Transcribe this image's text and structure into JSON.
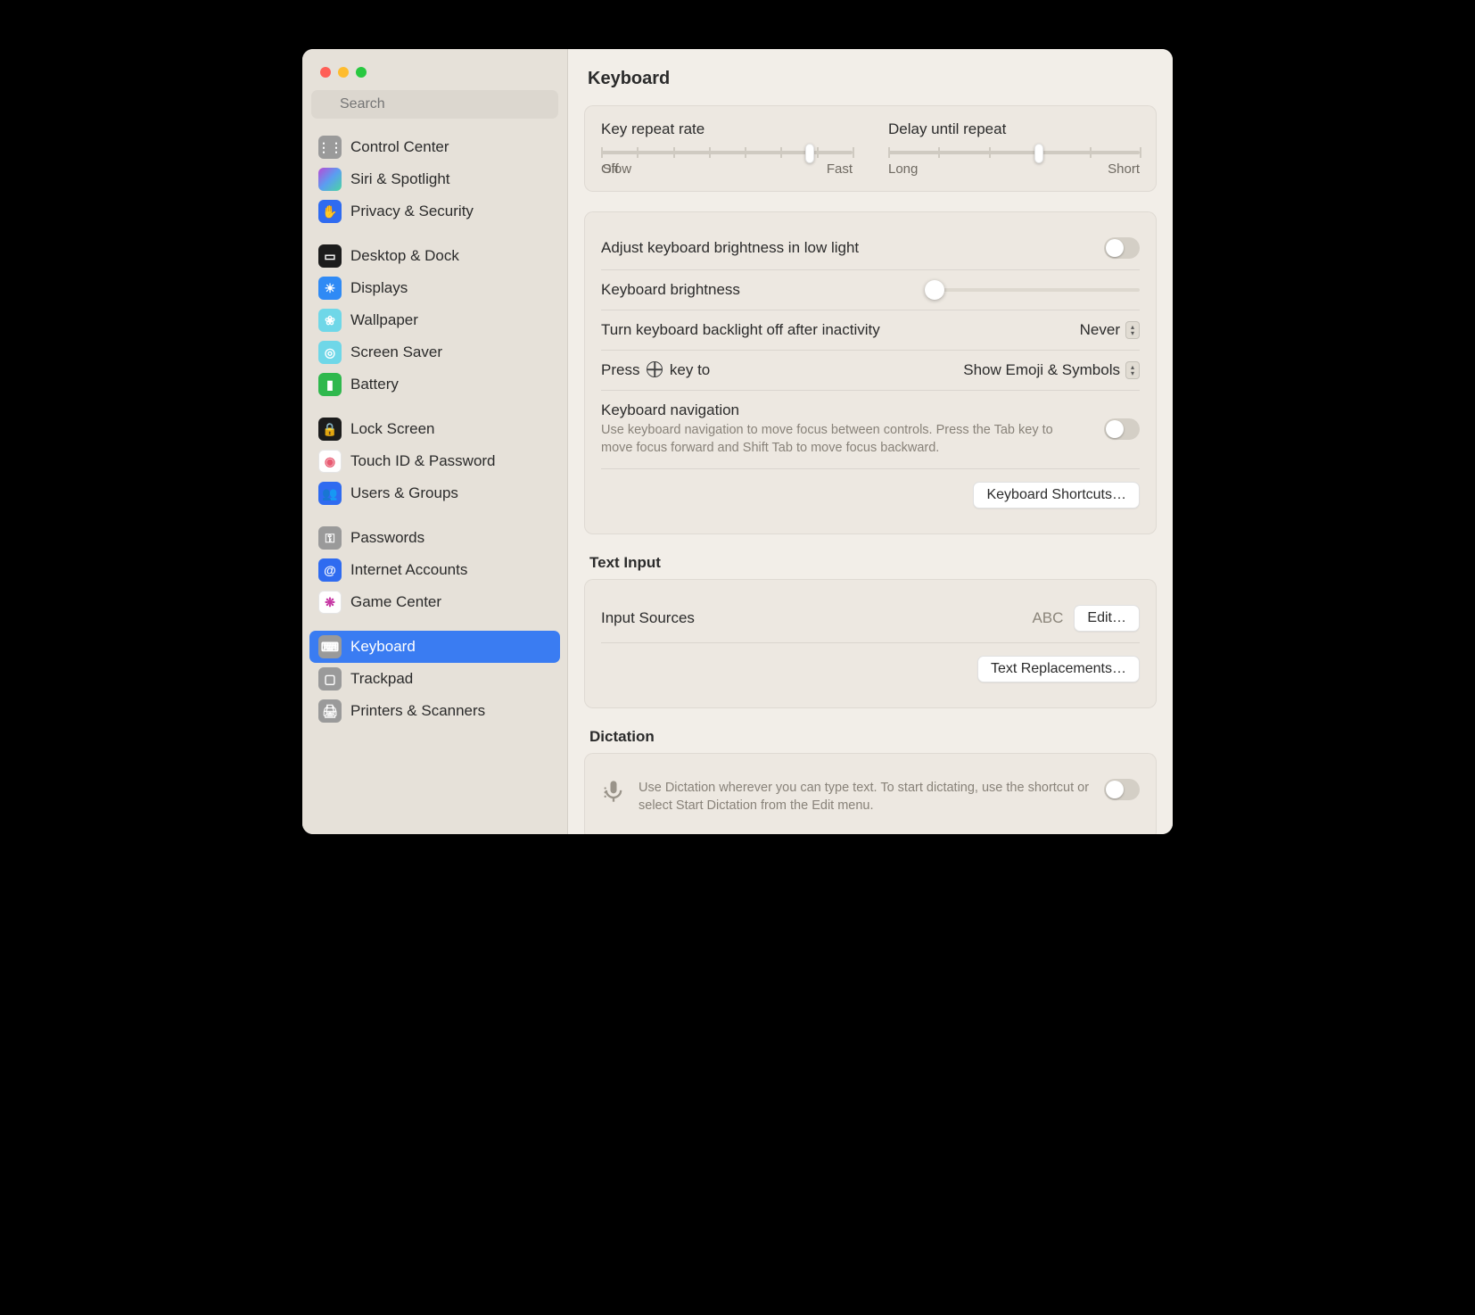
{
  "search": {
    "placeholder": "Search"
  },
  "page": {
    "title": "Keyboard"
  },
  "sidebar": {
    "groups": [
      [
        {
          "label": "Control Center",
          "bg": "#9a9a9a",
          "glyph": "⋮⋮"
        },
        {
          "label": "Siri & Spotlight",
          "bg": "linear-gradient(135deg,#b84bd6,#5a9ef1,#4ad6a1)",
          "glyph": ""
        },
        {
          "label": "Privacy & Security",
          "bg": "#2f6bf0",
          "glyph": "✋"
        }
      ],
      [
        {
          "label": "Desktop & Dock",
          "bg": "#1c1c1c",
          "glyph": "▭"
        },
        {
          "label": "Displays",
          "bg": "#2f8af5",
          "glyph": "☀"
        },
        {
          "label": "Wallpaper",
          "bg": "#6fd7e8",
          "glyph": "❀"
        },
        {
          "label": "Screen Saver",
          "bg": "#6fd7e8",
          "glyph": "◎"
        },
        {
          "label": "Battery",
          "bg": "#2fb84d",
          "glyph": "▮"
        }
      ],
      [
        {
          "label": "Lock Screen",
          "bg": "#1c1c1c",
          "glyph": "🔒"
        },
        {
          "label": "Touch ID & Password",
          "bg": "#fff",
          "fg": "#e85b72",
          "glyph": "◉"
        },
        {
          "label": "Users & Groups",
          "bg": "#2f6bf0",
          "glyph": "👥"
        }
      ],
      [
        {
          "label": "Passwords",
          "bg": "#9a9a9a",
          "glyph": "⚿"
        },
        {
          "label": "Internet Accounts",
          "bg": "#2f6bf0",
          "glyph": "@"
        },
        {
          "label": "Game Center",
          "bg": "#fff",
          "glyph": "❋",
          "fg": "#c738a4"
        }
      ],
      [
        {
          "label": "Keyboard",
          "bg": "#9a9a9a",
          "glyph": "⌨",
          "selected": true
        },
        {
          "label": "Trackpad",
          "bg": "#9a9a9a",
          "glyph": "▢"
        },
        {
          "label": "Printers & Scanners",
          "bg": "#9a9a9a",
          "glyph": "🖨"
        }
      ]
    ]
  },
  "sliders": {
    "repeat": {
      "title": "Key repeat rate",
      "left": "Off",
      "mid": "Slow",
      "right": "Fast",
      "ticks": 8,
      "value_pct": 83
    },
    "delay": {
      "title": "Delay until repeat",
      "left": "Long",
      "right": "Short",
      "ticks": 6,
      "value_pct": 60
    }
  },
  "rows": {
    "autoBright": "Adjust keyboard brightness in low light",
    "brightness": "Keyboard brightness",
    "brightness_pct": 4,
    "backlightOff": {
      "label": "Turn keyboard backlight off after inactivity",
      "value": "Never"
    },
    "globe": {
      "prefix": "Press ",
      "suffix": " key to",
      "value": "Show Emoji & Symbols"
    },
    "nav": {
      "title": "Keyboard navigation",
      "desc": "Use keyboard navigation to move focus between controls. Press the Tab key to move focus forward and Shift Tab to move focus backward."
    },
    "shortcutsBtn": "Keyboard Shortcuts…"
  },
  "textInput": {
    "header": "Text Input",
    "inputSources": {
      "label": "Input Sources",
      "value": "ABC",
      "edit": "Edit…"
    },
    "replacementsBtn": "Text Replacements…"
  },
  "dictation": {
    "header": "Dictation",
    "desc": "Use Dictation wherever you can type text. To start dictating, use the shortcut or select Start Dictation from the Edit menu."
  }
}
